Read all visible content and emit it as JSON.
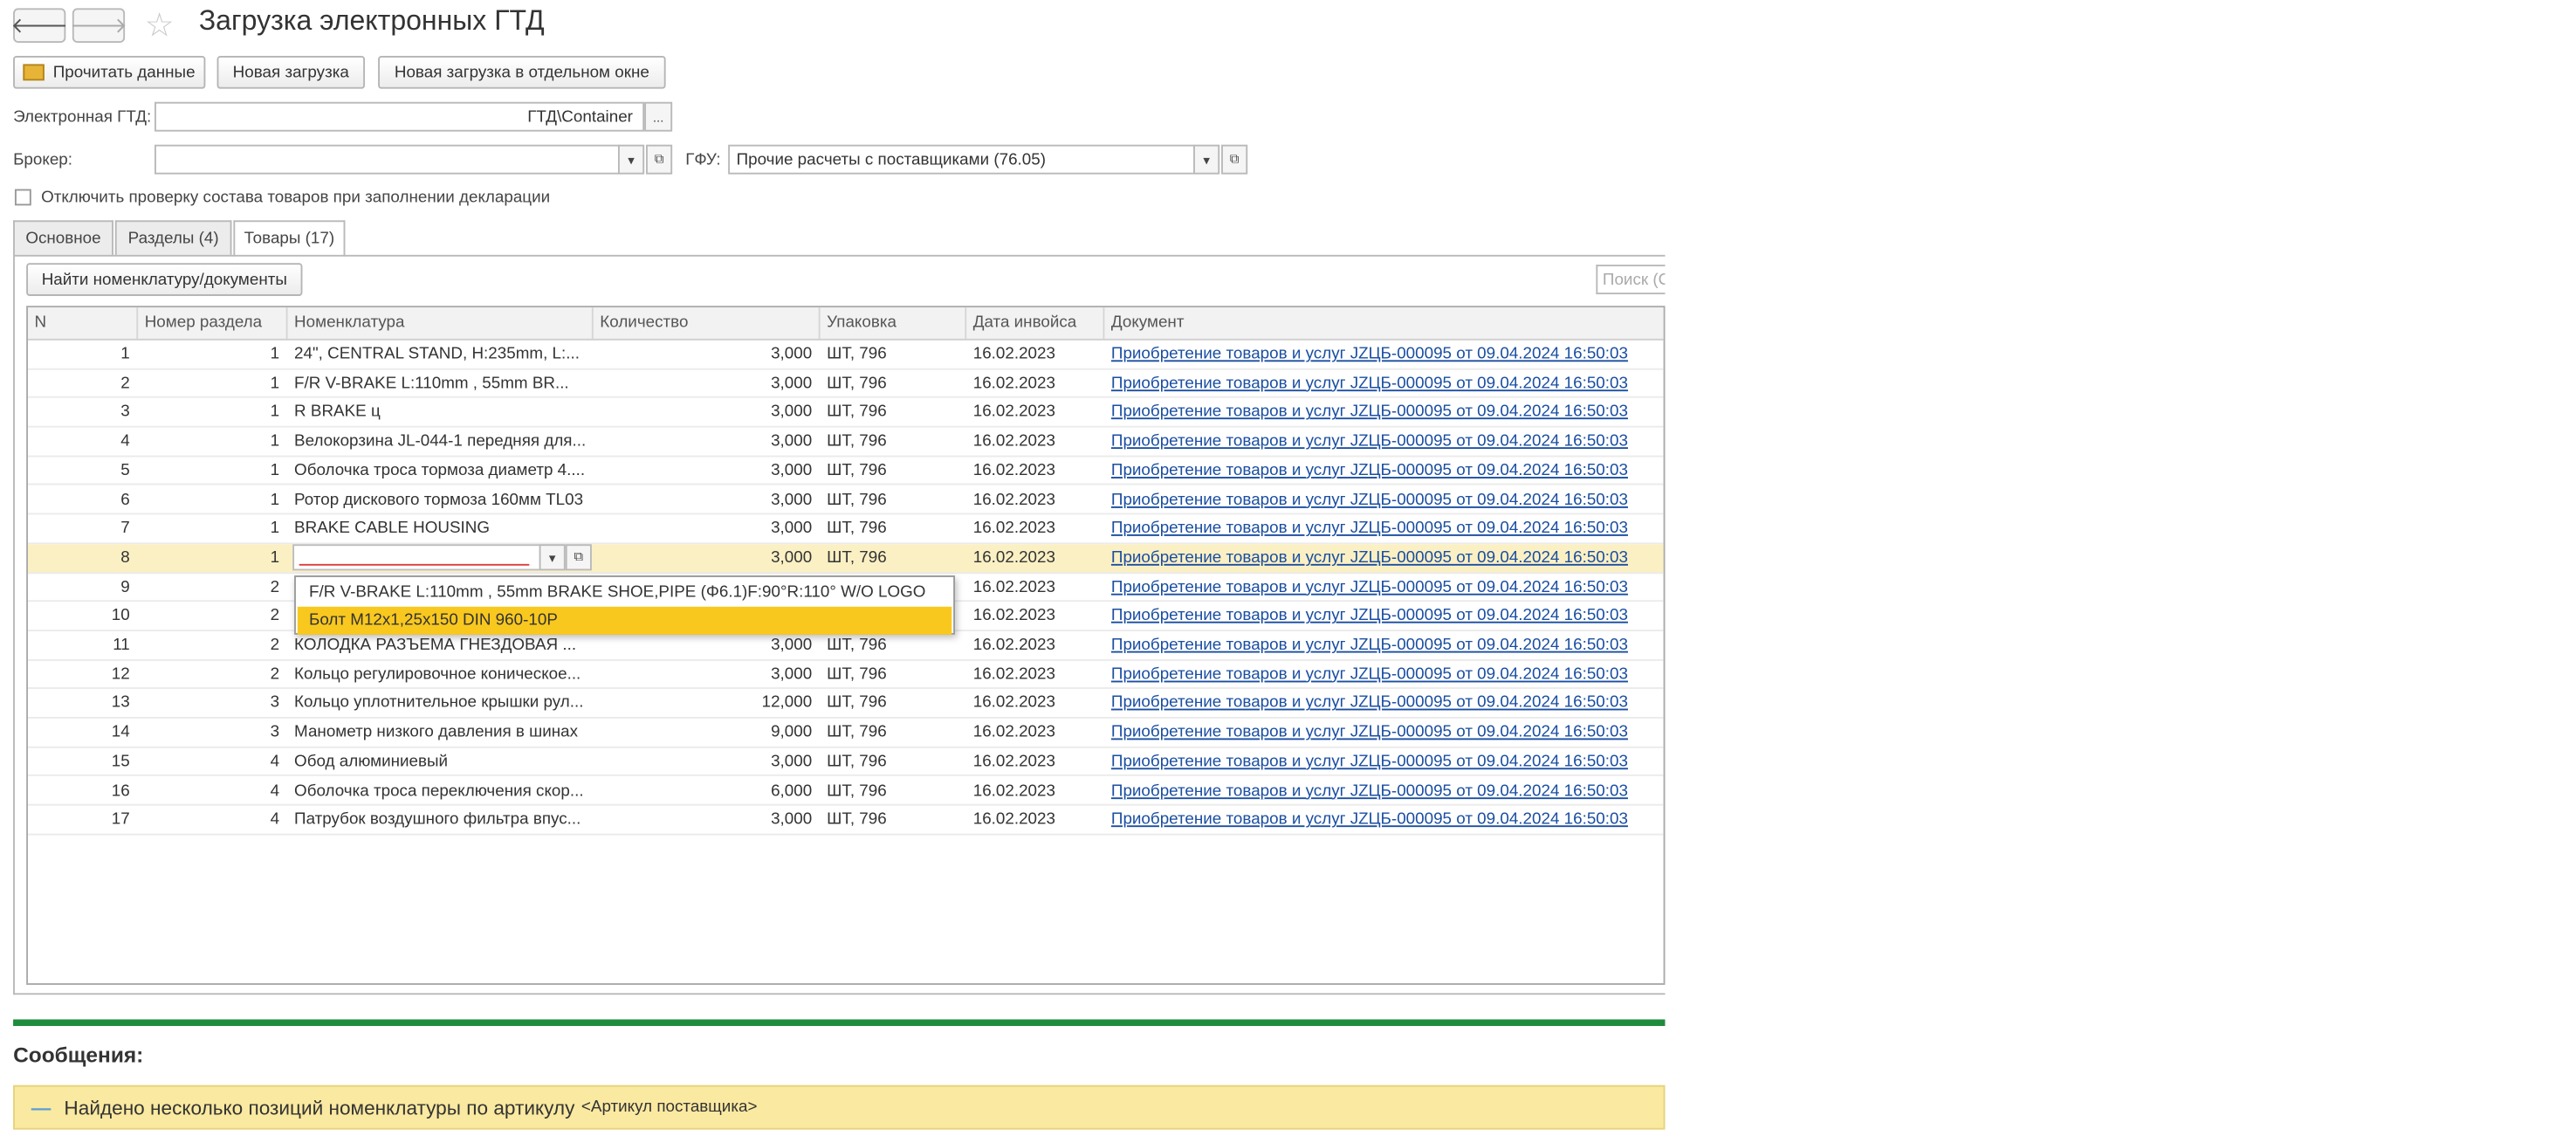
{
  "window": {
    "title": "Загрузка электронных ГТД"
  },
  "icons": {
    "back": "arrow-left-icon",
    "forward": "arrow-right-icon",
    "favorite": "star-icon",
    "read": "folder-open-icon",
    "dropdown": "chevron-down-icon",
    "open": "open-link-icon"
  },
  "toolbar": {
    "read_label": "Прочитать данные",
    "new_load_label": "Новая загрузка",
    "new_load_window_label": "Новая загрузка в отдельном окне"
  },
  "form": {
    "gtd_label": "Электронная ГТД:",
    "gtd_value": "ГТД\\Container",
    "gtd_select": "...",
    "broker_label": "Брокер:",
    "broker_value": "",
    "gfu_label": "ГФУ:",
    "gfu_value": "Прочие расчеты с поставщиками (76.05)",
    "check_label": "Отключить проверку состава товаров при заполнении декларации"
  },
  "tabs": [
    "Основное",
    "Разделы (4)",
    "Товары (17)"
  ],
  "goods": {
    "find_label": "Найти номенклатуру/документы",
    "search_placeholder": "Поиск (Ct",
    "columns": [
      "N",
      "Номер раздела",
      "Номенклатура",
      "Количество",
      "Упаковка",
      "Дата инвойса",
      "Документ"
    ],
    "rows": [
      {
        "n": "1",
        "section": "1",
        "item": "24\", CENTRAL STAND, H:235mm, L:...",
        "qty": "3,000",
        "pack": "ШТ, 796",
        "date": "16.02.2023",
        "doc": "Приобретение товаров и услуг JZЦБ-000095 от 09.04.2024 16:50:03"
      },
      {
        "n": "2",
        "section": "1",
        "item": "F/R V-BRAKE  L:110mm , 55mm BR...",
        "qty": "3,000",
        "pack": "ШТ, 796",
        "date": "16.02.2023",
        "doc": "Приобретение товаров и услуг JZЦБ-000095 от 09.04.2024 16:50:03"
      },
      {
        "n": "3",
        "section": "1",
        "item": "R BRAKE ц",
        "qty": "3,000",
        "pack": "ШТ, 796",
        "date": "16.02.2023",
        "doc": "Приобретение товаров и услуг JZЦБ-000095 от 09.04.2024 16:50:03"
      },
      {
        "n": "4",
        "section": "1",
        "item": "Велокорзина JL-044-1 передняя для...",
        "qty": "3,000",
        "pack": "ШТ, 796",
        "date": "16.02.2023",
        "doc": "Приобретение товаров и услуг JZЦБ-000095 от 09.04.2024 16:50:03"
      },
      {
        "n": "5",
        "section": "1",
        "item": "Оболочка троса тормоза диаметр 4....",
        "qty": "3,000",
        "pack": "ШТ, 796",
        "date": "16.02.2023",
        "doc": "Приобретение товаров и услуг JZЦБ-000095 от 09.04.2024 16:50:03"
      },
      {
        "n": "6",
        "section": "1",
        "item": "Ротор дискового тормоза 160мм TL03",
        "qty": "3,000",
        "pack": "ШТ, 796",
        "date": "16.02.2023",
        "doc": "Приобретение товаров и услуг JZЦБ-000095 от 09.04.2024 16:50:03"
      },
      {
        "n": "7",
        "section": "1",
        "item": "BRAKE CABLE HOUSING",
        "qty": "3,000",
        "pack": "ШТ, 796",
        "date": "16.02.2023",
        "doc": "Приобретение товаров и услуг JZЦБ-000095 от 09.04.2024 16:50:03"
      },
      {
        "n": "8",
        "section": "1",
        "item": "",
        "qty": "3,000",
        "pack": "ШТ, 796",
        "date": "16.02.2023",
        "doc": "Приобретение товаров и услуг JZЦБ-000095 от 09.04.2024 16:50:03"
      },
      {
        "n": "9",
        "section": "2",
        "item": "",
        "qty": "",
        "pack": "",
        "date": "16.02.2023",
        "doc": "Приобретение товаров и услуг JZЦБ-000095 от 09.04.2024 16:50:03"
      },
      {
        "n": "10",
        "section": "2",
        "item": "",
        "qty": "",
        "pack": "",
        "date": "16.02.2023",
        "doc": "Приобретение товаров и услуг JZЦБ-000095 от 09.04.2024 16:50:03"
      },
      {
        "n": "11",
        "section": "2",
        "item": "КОЛОДКА РАЗЪЕМА ГНЕЗДОВАЯ ...",
        "qty": "3,000",
        "pack": "ШТ, 796",
        "date": "16.02.2023",
        "doc": "Приобретение товаров и услуг JZЦБ-000095 от 09.04.2024 16:50:03"
      },
      {
        "n": "12",
        "section": "2",
        "item": "Кольцо регулировочное коническое...",
        "qty": "3,000",
        "pack": "ШТ, 796",
        "date": "16.02.2023",
        "doc": "Приобретение товаров и услуг JZЦБ-000095 от 09.04.2024 16:50:03"
      },
      {
        "n": "13",
        "section": "3",
        "item": "Кольцо уплотнительное крышки рул...",
        "qty": "12,000",
        "pack": "ШТ, 796",
        "date": "16.02.2023",
        "doc": "Приобретение товаров и услуг JZЦБ-000095 от 09.04.2024 16:50:03"
      },
      {
        "n": "14",
        "section": "3",
        "item": "Манометр низкого давления в шинах",
        "qty": "9,000",
        "pack": "ШТ, 796",
        "date": "16.02.2023",
        "doc": "Приобретение товаров и услуг JZЦБ-000095 от 09.04.2024 16:50:03"
      },
      {
        "n": "15",
        "section": "4",
        "item": "Обод алюминиевый",
        "qty": "3,000",
        "pack": "ШТ, 796",
        "date": "16.02.2023",
        "doc": "Приобретение товаров и услуг JZЦБ-000095 от 09.04.2024 16:50:03"
      },
      {
        "n": "16",
        "section": "4",
        "item": "Оболочка троса переключения скор...",
        "qty": "6,000",
        "pack": "ШТ, 796",
        "date": "16.02.2023",
        "doc": "Приобретение товаров и услуг JZЦБ-000095 от 09.04.2024 16:50:03"
      },
      {
        "n": "17",
        "section": "4",
        "item": "Патрубок воздушного фильтра впус...",
        "qty": "3,000",
        "pack": "ШТ, 796",
        "date": "16.02.2023",
        "doc": "Приобретение товаров и услуг JZЦБ-000095 от 09.04.2024 16:50:03"
      }
    ],
    "dropdown": [
      "F/R V-BRAKE  L:110mm , 55mm BRAKE SHOE,PIPE (Φ6.1)F:90°R:110° W/O LOGO",
      "Болт М12х1,25х150 DIN 960-10P"
    ]
  },
  "messages": {
    "title": "Сообщения:",
    "marker": "—",
    "text": "Найдено несколько позиций номенклатуры по артикулу",
    "tag": "<Артикул поставщика>"
  },
  "colors": {
    "accent_green": "#1e8c3c",
    "link": "#1a4ea1",
    "highlight": "#f9c81f",
    "selected_row": "#fbf0c4",
    "message_bg": "#fae9a0"
  }
}
